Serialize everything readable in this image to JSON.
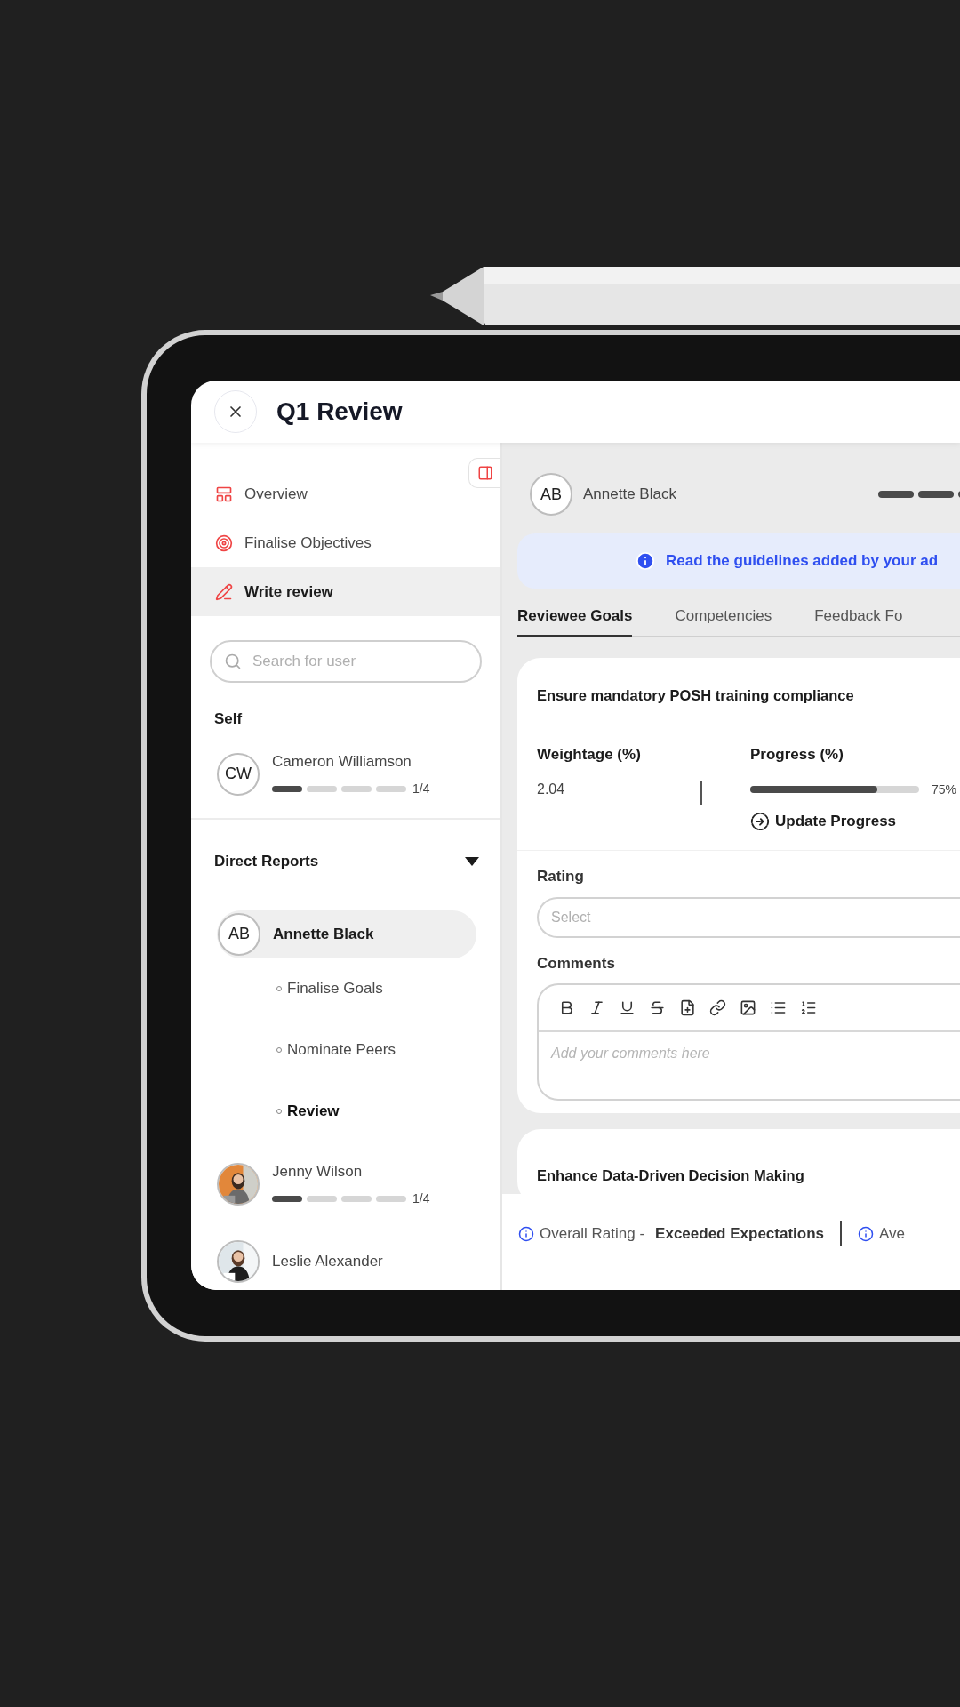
{
  "header": {
    "title": "Q1 Review"
  },
  "nav": [
    {
      "label": "Overview",
      "selected": false
    },
    {
      "label": "Finalise Objectives",
      "selected": false
    },
    {
      "label": "Write review",
      "selected": true
    }
  ],
  "search": {
    "placeholder": "Search for user"
  },
  "self": {
    "heading": "Self",
    "users": [
      {
        "kind": "initials",
        "initials": "CW",
        "name": "Cameron Williamson",
        "level": 0.25,
        "count": "1/4"
      }
    ]
  },
  "direct_reports": {
    "heading": "Direct Reports",
    "expanded": true,
    "users": [
      {
        "kind": "initials",
        "initials": "AB",
        "name": "Annette Black",
        "selected": true,
        "children": [
          {
            "label": "Finalise Goals",
            "selected": false
          },
          {
            "label": "Nominate Peers",
            "selected": false
          },
          {
            "label": "Review",
            "selected": true
          }
        ]
      },
      {
        "kind": "picture",
        "name": "Jenny Wilson",
        "selected": false,
        "level": 0.25,
        "count": "1/4"
      },
      {
        "kind": "picture",
        "name": "Leslie Alexander",
        "selected": false
      }
    ]
  },
  "reviewee": {
    "initials": "AB",
    "name": "Annette Black"
  },
  "banner": {
    "text": "Read the guidelines added by your ad"
  },
  "tabs": [
    {
      "label": "Reviewee Goals",
      "selected": true
    },
    {
      "label": "Competencies",
      "selected": false
    },
    {
      "label": "Feedback Fo",
      "selected": false
    }
  ],
  "goals": [
    {
      "title": "Ensure mandatory POSH training compliance",
      "weightage_label": "Weightage (%)",
      "weightage": "2.04",
      "progress_label": "Progress (%)",
      "level": 0.75,
      "reading": "75%",
      "action": "Update Progress",
      "rating_label": "Rating",
      "rating_placeholder": "Select",
      "comments_label": "Comments",
      "comments_placeholder": "Add your comments here"
    },
    {
      "title": "Enhance Data-Driven Decision Making"
    }
  ],
  "footer": [
    {
      "label": "Overall Rating -",
      "value": "Exceeded Expectations"
    },
    {
      "label": "Ave"
    }
  ]
}
